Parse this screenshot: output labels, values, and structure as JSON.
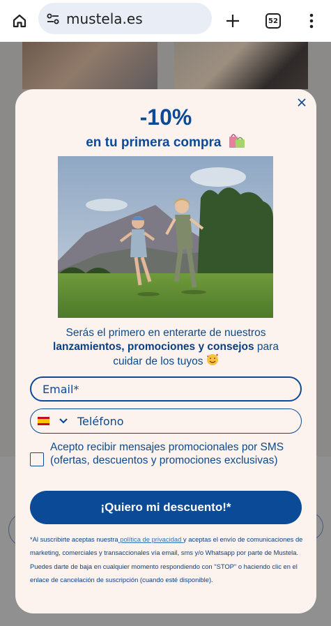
{
  "browser": {
    "url": "mustela.es",
    "tab_count": "52",
    "icons": {
      "home": "home-icon",
      "site_settings": "tune-icon",
      "new_tab": "plus-icon",
      "menu": "more-vert-icon"
    }
  },
  "modal": {
    "discount": "-10%",
    "subtitle": "en tu primera compra",
    "description_1": "Serás el primero en enterarte de nuestros",
    "description_bold": "lanzamientos, promociones y consejos",
    "description_2": "para",
    "description_3": "cuidar de los tuyos",
    "email_placeholder": "Email*",
    "phone_placeholder": "Teléfono",
    "country": "ES",
    "sms_consent": "Acepto recibir mensajes promocionales por SMS (ofertas, descuentos y promociones exclusivas)",
    "cta_label": "¡Quiero mi descuento!*",
    "legal_1": "*Al suscribirte aceptas nuestra",
    "legal_link": " política de privacidad ",
    "legal_2": "y aceptas el envío de comunicaciones de marketing, comerciales y transaccionales vía email, sms y/o Whatsapp por parte de Mustela. Puedes darte de baja en cualquier momento respondiendo con \"STOP\" o haciendo clic en el enlace de cancelación de suscripción (cuando esté disponible).",
    "colors": {
      "brand_blue": "#0a4a96",
      "modal_bg": "#fdf3ee"
    }
  }
}
